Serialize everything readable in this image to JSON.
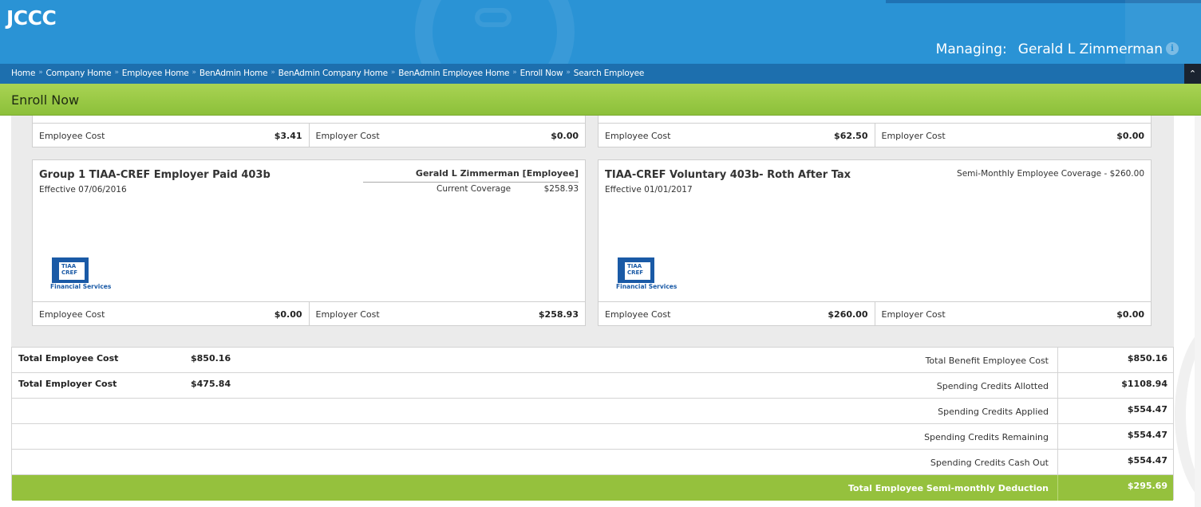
{
  "app": {
    "logo": "JCCC"
  },
  "managing": {
    "label": "Managing:",
    "name": "Gerald L Zimmerman"
  },
  "breadcrumb": {
    "items": [
      "Home",
      "Company Home",
      "Employee Home",
      "BenAdmin Home",
      "BenAdmin Company Home",
      "BenAdmin Employee Home",
      "Enroll Now",
      "Search Employee"
    ],
    "separator": "»"
  },
  "page": {
    "title": "Enroll Now"
  },
  "cost_labels": {
    "employee": "Employee Cost",
    "employer": "Employer Cost"
  },
  "cards_top": [
    {
      "employee_cost": "$3.41",
      "employer_cost": "$0.00"
    },
    {
      "employee_cost": "$62.50",
      "employer_cost": "$0.00"
    }
  ],
  "cards": [
    {
      "plan": "Group 1 TIAA-CREF Employer Paid 403b",
      "effective": "Effective 07/06/2016",
      "covered_person": "Gerald L Zimmerman [Employee]",
      "coverage_label": "Current Coverage",
      "coverage_value": "$258.93",
      "logo": {
        "line1": "TIAA",
        "line2": "CREF",
        "sub": "Financial Services"
      },
      "employee_cost": "$0.00",
      "employer_cost": "$258.93"
    },
    {
      "plan": "TIAA-CREF Voluntary 403b- Roth After Tax",
      "effective": "Effective 01/01/2017",
      "coverage_note": "Semi-Monthly Employee Coverage - $260.00",
      "logo": {
        "line1": "TIAA",
        "line2": "CREF",
        "sub": "Financial Services"
      },
      "employee_cost": "$260.00",
      "employer_cost": "$0.00"
    }
  ],
  "totals": {
    "left": [
      {
        "label": "Total Employee Cost",
        "value": "$850.16"
      },
      {
        "label": "Total Employer Cost",
        "value": "$475.84"
      }
    ],
    "right": [
      {
        "label": "Total Benefit Employee Cost",
        "value": "$850.16"
      },
      {
        "label": "Spending Credits Allotted",
        "value": "$1108.94"
      },
      {
        "label": "Spending Credits Applied",
        "value": "$554.47"
      },
      {
        "label": "Spending Credits Remaining",
        "value": "$554.47"
      },
      {
        "label": "Spending Credits Cash Out",
        "value": "$554.47"
      }
    ],
    "final": {
      "label": "Total Employee Semi-monthly Deduction",
      "value": "$295.69"
    }
  },
  "colors": {
    "header": "#2a93d5",
    "breadcrumb": "#1d6fae",
    "title_bar": "#95c13d",
    "accent_green": "#95c13d",
    "tiaa_blue": "#1a5aa6"
  }
}
